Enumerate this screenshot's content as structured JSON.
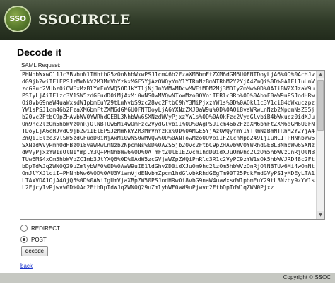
{
  "header": {
    "logo_badge_text": "SSO",
    "logo_text": "SSOCIRCLE"
  },
  "main": {
    "title": "Decode it",
    "saml_label": "SAML Request:",
    "saml_request": "PHNhbWxwOl1Jc3BvbnN1IHhtbG5zOnNhbWxwPSJ1cm46b2FzaXM6bmFtZXM6dGM6U0FNTDoyLjA6%0D%0AcHJvdG9jb2wiIElEPSJzMmNkY2M3MmVhYzkxMGE5YjAzOWQyYmY1YTRmNzBmNTRhM2Y2YjA4ZmQi%0D%0AIElIuUmVzcG9uc2VUbz0iOWExMzBlYmFmYWQ5ODJkYTljNjJmYWMwMDcwMWFiMDM2Mj3MDIyZmMw%0D%0AIiBWZXJzaW9uPSIyLjAiIElzc3V1SW5zdGFudD0iMjAxMi0wNS0wMVQwNTowMzo0OVoiIERlc3Rp%0D%0AbmF0aW9uPSJodHRwOi8vbG9naW4uaWxsdW1pbmEuY29tLmNvbS9zc28vc2FtbC9hY3MiPjxzYW1s%0D%0AOkl1c3V1ciB4bWxuczpzYW1sPSJ1cm46b2FzaXM6bmFtZXM6dGM6U0FNTDoyLjA6YXNzZXJ0aW9u%0D%0AOi8vaWRwLnNzb2NpcmNsZS5jb20vc2FtbC9pZHAvbWV0YWRhdGE8L3NhbWw6SXNzdWVyPjxzYW1s%0D%0AOkFzc2VydGlvbiB4bWxucz0idXJuOm9hc2lzOm5hbWVzOnRjOlNBTUw6Mi4wOmFzc2VydGlvbiI%0D%0AgPSJ1cm46b2FzaXM6bmFtZXM6dGM6U0FNTDoyLjA6cHJvdG9jb2wiIElEPSJzMmNkY2M3MmVhYzkx%0D%0AMGE5YjAzOWQyYmY1YTRmNzBmNTRhM2Y2YjA4ZmQiIElzc3VlSW5zdGFudD0iMjAxMi0wNS0wMVQw%0D%0ANTowMzo0OVoiIFZlcnNpb249IjIuMCI+PHNhbWw6SXNzdWVyPmh0dHBzOi8vaWRwLnNzb2NpcmNs%0D%0AZS5jb20vc2FtbC9pZHAvbWV0YWRhdGE8L3NhbWw6SXNzdWVyPjxzYW1sOlN1YmplY3Q+PHNhbWw6%0D%0ATmFtZUlEIEZvcm1hdD0idXJuOm9hc2lzOm5hbWVzOnRjOlNBTUw6MS4xOm5hbWVpZC1mb3JtYXQ6%0D%0AdW5zcGVjaWZpZWQiPnRlc3R1c2VyPC9zYW1sOk5hbWVJRD48c2FtbDpTdWJqZWN0Q29uZmlybWF0%0D%0AaW9uIE1ldGhvZD0idXJuOm9hc2lzOm5hbWVzOnRjOlNBTUw6Mi4wOmNtOmJlYXJlciI+PHNhbWw6%0D%0AU3ViamVjdENvbmZpcm1hdGlvbkRhdGEgTm90T25PckFmdGVyPSIyMDEyLTA1LTAxVDA1OjA4OjQ5%0D%0AWiIgUmVjaXBpZW50PSJodHRwOi8vbG9naW4uaWxsdW1pbmEuY29tL3Nzby9zYW1sL2FjcyIvPjwv%0D%0Ac2FtbDpTdWJqZWN0Q29uZmlybWF0aW9uPjwvc2FtbDpTdWJqZWN0Pjxz",
    "binding_options": [
      {
        "label": "REDIRECT",
        "checked": false
      },
      {
        "label": "POST",
        "checked": true
      }
    ],
    "decode_label": "decode",
    "back_label": "back"
  },
  "footer": {
    "copyright": "Copyright © SSOC"
  },
  "colors": {
    "header_bg": "#2f3a27",
    "link": "#1a33cc",
    "footer_bg": "#c6c8c2"
  }
}
